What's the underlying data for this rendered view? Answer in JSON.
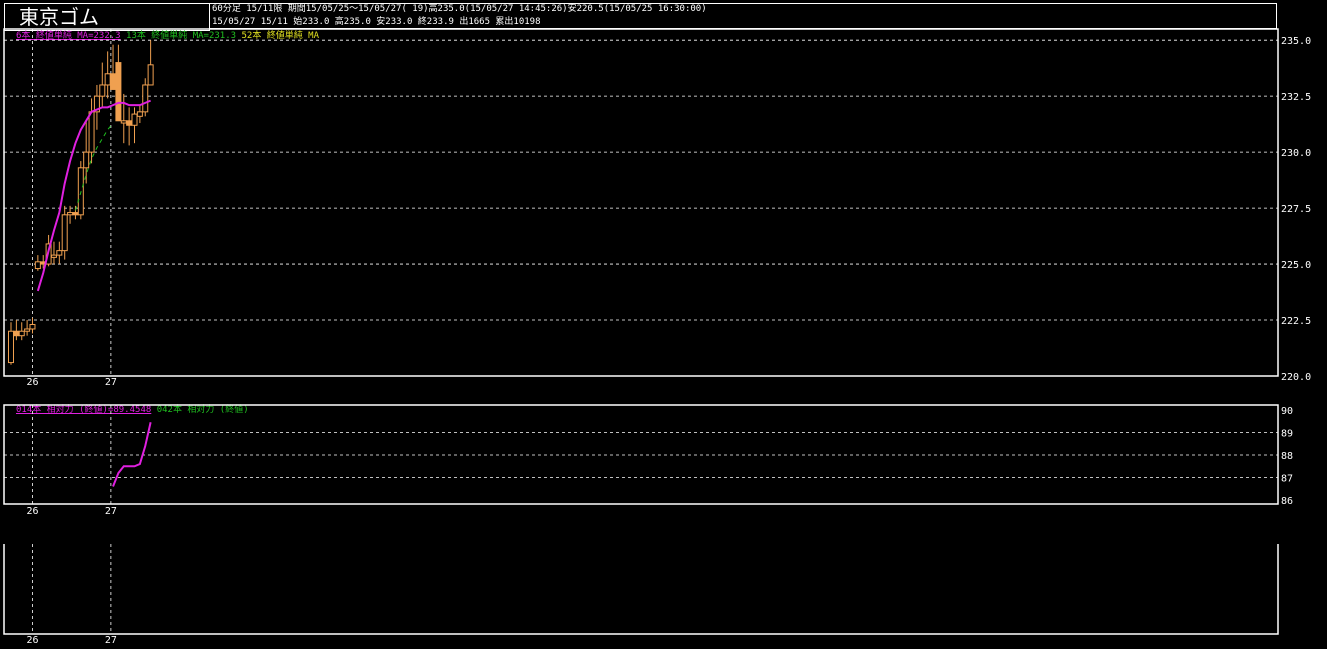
{
  "header": {
    "title": "東京ゴム",
    "info_line1": "60分足 15/11限 期間15/05/25～15/05/27( 19)高235.0(15/05/27 14:45:26)安220.5(15/05/25 16:30:00)",
    "info_line2": "15/05/27 15/11 始233.0 高235.0 安233.0 終233.9 出1665 累出10198"
  },
  "colors": {
    "background": "#000000",
    "frame": "#ffffff",
    "grid": "#ffffff",
    "candle": "#f0a050",
    "ma6": "#e020e0",
    "ma13": "#20c020",
    "ma52": "#e0e020",
    "rsi14": "#e020e0",
    "rsi42": "#20c020"
  },
  "price_panel": {
    "legend": [
      {
        "text": "6本 終値単純 MA=232.3",
        "color": "#e020e0"
      },
      {
        "text": "13本 終値単純 MA=231.3",
        "color": "#20c020"
      },
      {
        "text": "52本 終値単純 MA",
        "color": "#e0e020"
      }
    ],
    "y_ticks": [
      "235.0",
      "232.5",
      "230.0",
      "227.5",
      "225.0",
      "222.5",
      "220.0"
    ],
    "x_ticks": [
      "26",
      "27"
    ]
  },
  "rsi_panel": {
    "legend": [
      {
        "text": "014本 相対力 (終値)=89.4548",
        "color": "#e020e0"
      },
      {
        "text": "042本 相対力 (終値)",
        "color": "#20c020"
      }
    ],
    "y_ticks": [
      "90",
      "89",
      "88",
      "87",
      "86"
    ],
    "x_ticks": [
      "26",
      "27"
    ]
  },
  "empty_panel": {
    "x_ticks": [
      "26",
      "27"
    ]
  },
  "chart_data": {
    "type": "candlestick",
    "title": "東京ゴム",
    "ylim": [
      220.0,
      235.5
    ],
    "x_day_labels": [
      "26",
      "27"
    ],
    "candles": [
      {
        "o": 220.6,
        "h": 222.4,
        "l": 220.5,
        "c": 222.0
      },
      {
        "o": 222.0,
        "h": 222.5,
        "l": 221.6,
        "c": 221.8
      },
      {
        "o": 221.8,
        "h": 222.4,
        "l": 221.6,
        "c": 222.0
      },
      {
        "o": 222.0,
        "h": 222.5,
        "l": 221.8,
        "c": 222.1
      },
      {
        "o": 222.1,
        "h": 222.6,
        "l": 221.9,
        "c": 222.3
      },
      {
        "o": 224.8,
        "h": 225.4,
        "l": 224.7,
        "c": 225.1
      },
      {
        "o": 225.1,
        "h": 225.4,
        "l": 224.8,
        "c": 225.0
      },
      {
        "o": 225.0,
        "h": 226.3,
        "l": 224.9,
        "c": 225.9
      },
      {
        "o": 225.3,
        "h": 226.0,
        "l": 225.0,
        "c": 225.4
      },
      {
        "o": 225.4,
        "h": 226.0,
        "l": 225.0,
        "c": 225.6
      },
      {
        "o": 225.6,
        "h": 227.6,
        "l": 225.2,
        "c": 227.2
      },
      {
        "o": 227.2,
        "h": 227.6,
        "l": 226.8,
        "c": 227.3
      },
      {
        "o": 227.3,
        "h": 227.6,
        "l": 227.0,
        "c": 227.2
      },
      {
        "o": 227.2,
        "h": 229.6,
        "l": 227.0,
        "c": 229.3
      },
      {
        "o": 229.3,
        "h": 231.4,
        "l": 228.6,
        "c": 230.0
      },
      {
        "o": 230.0,
        "h": 232.4,
        "l": 229.5,
        "c": 231.8
      },
      {
        "o": 231.8,
        "h": 233.0,
        "l": 231.0,
        "c": 232.5
      },
      {
        "o": 232.5,
        "h": 234.0,
        "l": 232.0,
        "c": 233.0
      },
      {
        "o": 233.0,
        "h": 234.5,
        "l": 232.4,
        "c": 233.5
      },
      {
        "o": 233.5,
        "h": 234.8,
        "l": 232.8,
        "c": 232.8
      },
      {
        "o": 234.0,
        "h": 234.8,
        "l": 231.4,
        "c": 231.4
      },
      {
        "o": 231.3,
        "h": 232.6,
        "l": 230.4,
        "c": 231.4
      },
      {
        "o": 231.4,
        "h": 232.0,
        "l": 230.3,
        "c": 231.2
      },
      {
        "o": 231.2,
        "h": 232.0,
        "l": 230.4,
        "c": 231.7
      },
      {
        "o": 231.6,
        "h": 232.1,
        "l": 231.3,
        "c": 231.8
      },
      {
        "o": 231.8,
        "h": 233.3,
        "l": 231.6,
        "c": 233.0
      },
      {
        "o": 233.0,
        "h": 235.0,
        "l": 233.0,
        "c": 233.9
      }
    ],
    "ma6": [
      null,
      null,
      null,
      null,
      null,
      223.8,
      224.6,
      225.6,
      226.5,
      227.3,
      228.6,
      229.6,
      230.4,
      231.0,
      231.4,
      231.8,
      231.9,
      232.0,
      232.0,
      232.1,
      232.2,
      232.2,
      232.1,
      232.1,
      232.1,
      232.2,
      232.3
    ],
    "ma13": [
      null,
      null,
      null,
      null,
      null,
      null,
      null,
      null,
      null,
      null,
      null,
      null,
      227.4,
      228.2,
      229.0,
      229.7,
      230.2,
      230.6,
      231.0,
      231.3
    ],
    "rsi14": [
      86.6,
      87.2,
      87.5,
      87.5,
      87.5,
      87.6,
      88.4,
      89.4548
    ],
    "rsi_ylim": [
      86.0,
      90.0
    ]
  }
}
